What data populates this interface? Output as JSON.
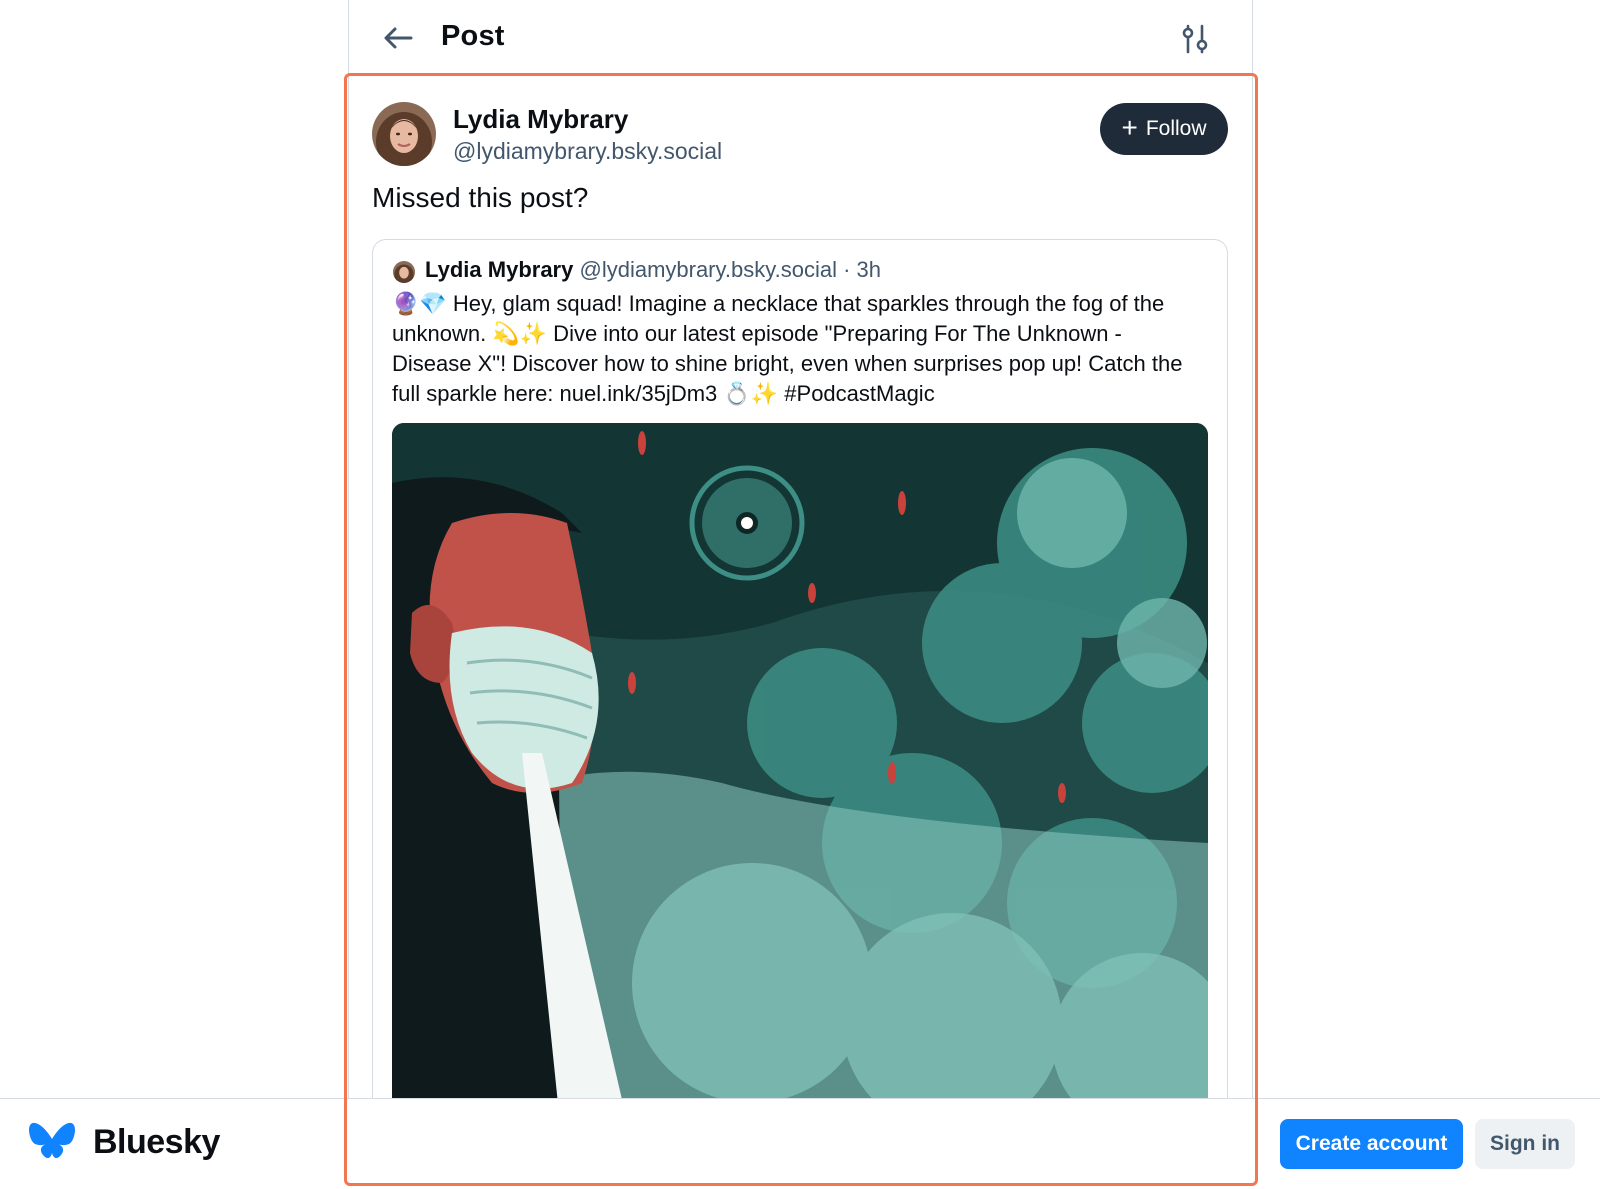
{
  "header": {
    "title": "Post",
    "back_icon": "arrow-left-icon",
    "filter_icon": "sliders-icon"
  },
  "post": {
    "author_name": "Lydia Mybrary",
    "author_handle": "@lydiamybrary.bsky.social",
    "follow_label": "Follow",
    "text": "Missed this post?"
  },
  "quote": {
    "author_name": "Lydia Mybrary",
    "author_handle": "@lydiamybrary.bsky.social",
    "time": "· 3h",
    "text": "🔮💎 Hey, glam squad! Imagine a necklace that sparkles through the fog of the unknown. 💫✨ Dive into our latest episode \"Preparing For The Unknown - Disease X\"! Discover how to shine bright, even when surprises pop up! Catch the full sparkle here: nuel.ink/35jDm3 💍✨ #PodcastMagic"
  },
  "footer": {
    "brand": "Bluesky",
    "create_account": "Create account",
    "sign_in": "Sign in"
  },
  "colors": {
    "accent": "#1083fe",
    "highlight": "#f2764f",
    "follow_bg": "#1f2b38"
  }
}
